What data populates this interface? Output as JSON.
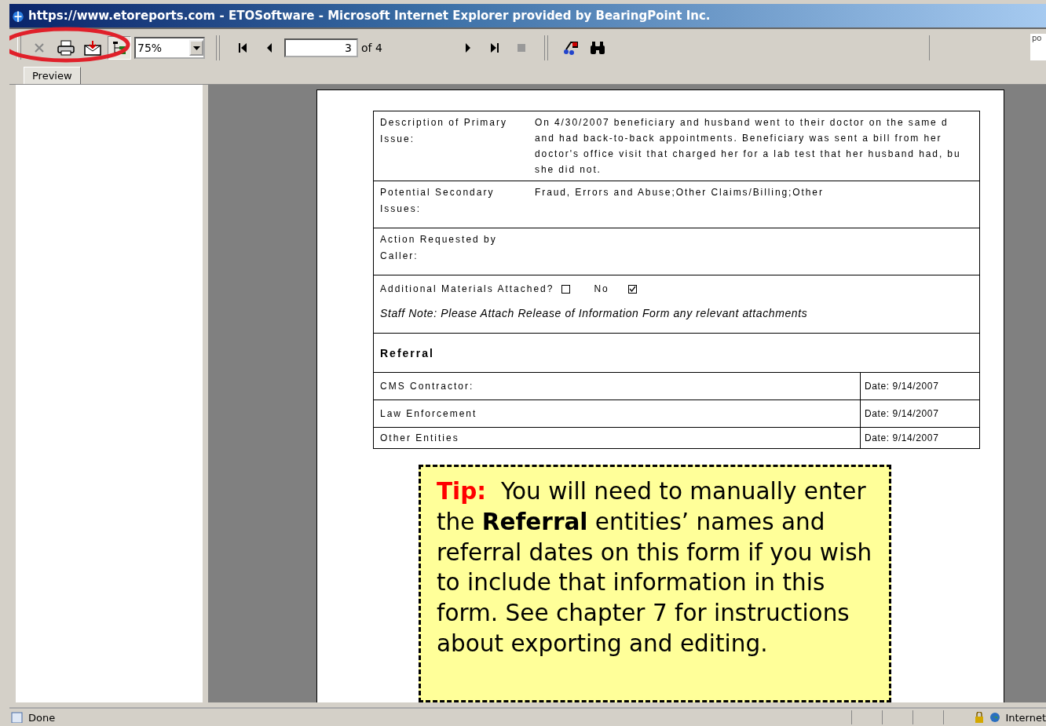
{
  "window": {
    "title": "https://www.etoreports.com - ETOSoftware - Microsoft Internet Explorer provided by BearingPoint Inc."
  },
  "toolbar": {
    "group_tree_pressed": true,
    "zoom": "75%",
    "page": "3",
    "page_of": "of 4",
    "right_field": "po"
  },
  "tabs": [
    {
      "label": "Preview",
      "selected": true
    }
  ],
  "form": {
    "rows": [
      {
        "kind": "field",
        "label": "Description of Primary Issue:",
        "value_lines": [
          "On 4/30/2007 beneficiary and husband went to their doctor on the same d",
          "and had back-to-back appointments.  Beneficiary was sent a bill from her",
          "doctor's office visit that charged her for a lab test that her husband had, bu",
          "she did not."
        ]
      },
      {
        "kind": "field",
        "label": "Potential Secondary Issues:",
        "value_lines": [
          "Fraud, Errors and Abuse;Other Claims/Billing;Other"
        ]
      },
      {
        "kind": "field",
        "label": "Action Requested by Caller:",
        "value_lines": []
      },
      {
        "kind": "attach",
        "label": "Additional Materials Attached?",
        "first_checked": false,
        "option": "No",
        "second_checked": true,
        "note": "Staff Note:  Please Attach Release of Information Form any relevant attachments"
      },
      {
        "kind": "heading",
        "label": "Referral"
      }
    ],
    "referrals": [
      {
        "name": "CMS Contractor:",
        "date": "Date: 9/14/2007"
      },
      {
        "name": "Law Enforcement",
        "date": "Date: 9/14/2007"
      },
      {
        "name": "Other Entities",
        "date": "Date: 9/14/2007"
      }
    ]
  },
  "tip": {
    "lead": "Tip:",
    "text": "You will need to manually enter the **Referral** entities’ names and referral dates on this form if you wish to include that information in this form.  See chapter 7 for instructions about exporting and editing."
  },
  "status_bar": {
    "status": "Done",
    "zone": "Internet"
  }
}
